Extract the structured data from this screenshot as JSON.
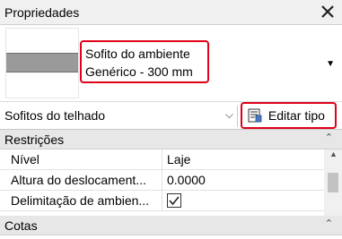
{
  "palette": {
    "title": "Propriedades",
    "close_icon": "close-x-icon"
  },
  "type_preview": {
    "line1": "Sofito do ambiente",
    "line2": "Genérico - 300 mm"
  },
  "instance_selector": {
    "value": "Sofitos do telhado",
    "edit_type_label": "Editar tipo",
    "edit_type_icon": "edit-type-icon"
  },
  "categories": [
    {
      "name": "Restrições"
    },
    {
      "name": "Cotas"
    }
  ],
  "properties": [
    {
      "name": "Nível",
      "value": "Laje"
    },
    {
      "name": "Altura do deslocament...",
      "value": "0.0000"
    },
    {
      "name": "Delimitação de ambien...",
      "checked": true
    }
  ],
  "colors": {
    "highlight": "#e0001a",
    "category_bg": "#e7e7e7"
  }
}
